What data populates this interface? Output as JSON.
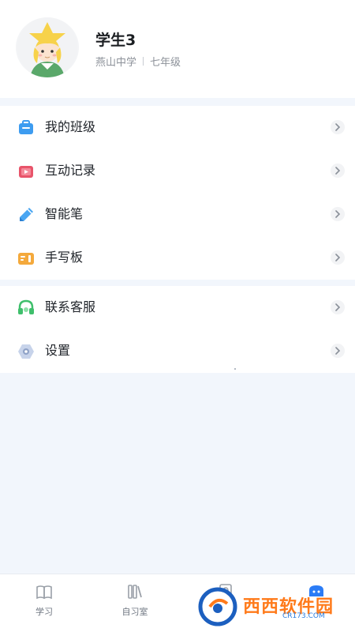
{
  "profile": {
    "name": "学生3",
    "school": "燕山中学",
    "grade": "七年级"
  },
  "menu": {
    "group1": [
      {
        "label": "我的班级",
        "icon": "class-icon",
        "color": "#3d9cf0"
      },
      {
        "label": "互动记录",
        "icon": "record-icon",
        "color": "#e8546a"
      },
      {
        "label": "智能笔",
        "icon": "pen-icon",
        "color": "#4aa6f2"
      },
      {
        "label": "手写板",
        "icon": "tablet-icon",
        "color": "#f4a93c"
      }
    ],
    "group2": [
      {
        "label": "联系客服",
        "icon": "headset-icon",
        "color": "#3fbf6c"
      },
      {
        "label": "设置",
        "icon": "settings-icon",
        "color": "#8fa2c7"
      }
    ]
  },
  "tabbar": {
    "tabs": [
      {
        "label": "学习",
        "icon": "book-icon"
      },
      {
        "label": "自习室",
        "icon": "study-room-icon"
      },
      {
        "label": "",
        "icon": "certificate-icon"
      },
      {
        "label": "",
        "icon": "profile-icon",
        "active": true
      }
    ],
    "accent": "#2b7cf6"
  },
  "watermark": {
    "text": "西西软件园",
    "sub": "CR173.COM"
  }
}
